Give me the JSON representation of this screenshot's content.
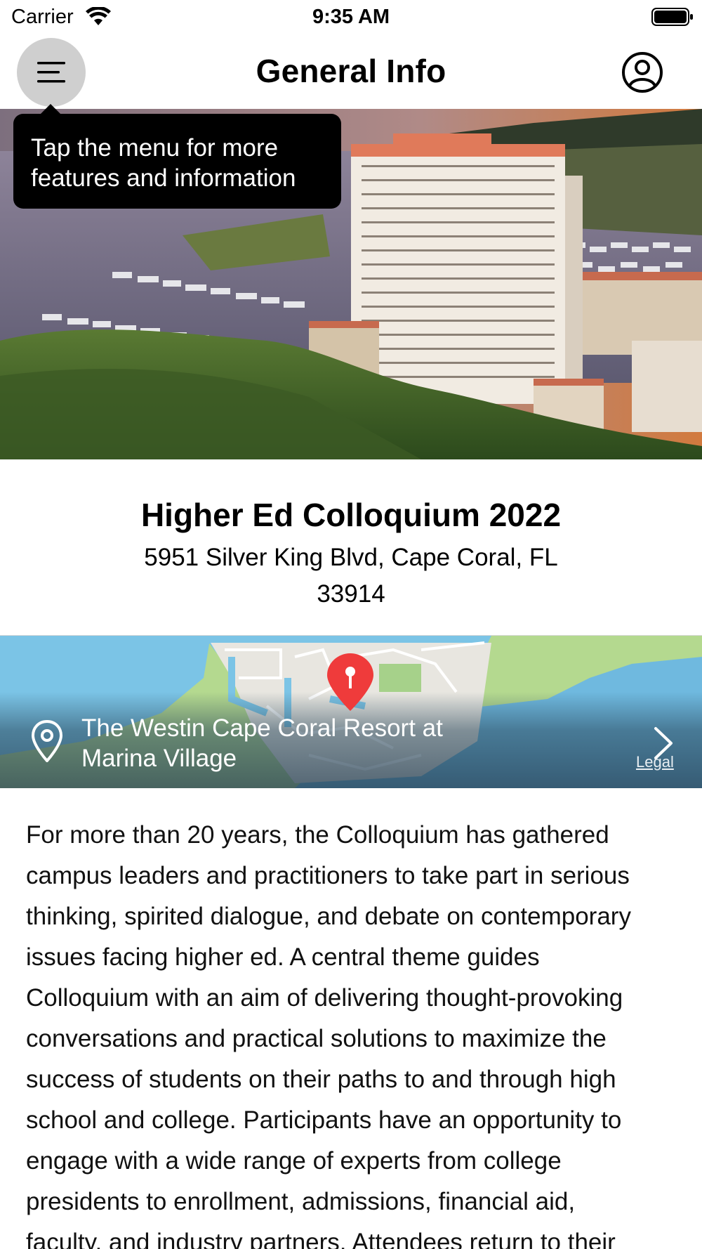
{
  "status_bar": {
    "carrier": "Carrier",
    "time": "9:35 AM"
  },
  "nav": {
    "title": "General Info",
    "menu_icon": "hamburger-menu-icon",
    "profile_icon": "user-circle-icon"
  },
  "tooltip": {
    "line1": "Tap the menu for more",
    "line2": "features and information"
  },
  "event": {
    "title": "Higher Ed Colloquium 2022",
    "address_line1": "5951 Silver King Blvd, Cape Coral, FL",
    "address_line2": "33914"
  },
  "map": {
    "venue_line1": "The Westin Cape Coral Resort at",
    "venue_line2": "Marina Village",
    "legal": "Legal",
    "pin_color": "#ef3b3b"
  },
  "description": {
    "lines": [
      "For more than 20 years, the Colloquium has gathered",
      "campus leaders and practitioners to take part in serious",
      "thinking, spirited dialogue, and debate on contemporary",
      "issues facing higher ed. A central theme guides",
      "Colloquium with an aim of delivering thought-provoking",
      "conversations and practical solutions to maximize the",
      "success of students on their paths to and through high",
      "school and college. Participants have an opportunity to",
      "engage with a wide range of experts from college",
      "presidents to enrollment, admissions, financial aid,",
      "faculty, and industry partners. Attendees return to their"
    ]
  }
}
